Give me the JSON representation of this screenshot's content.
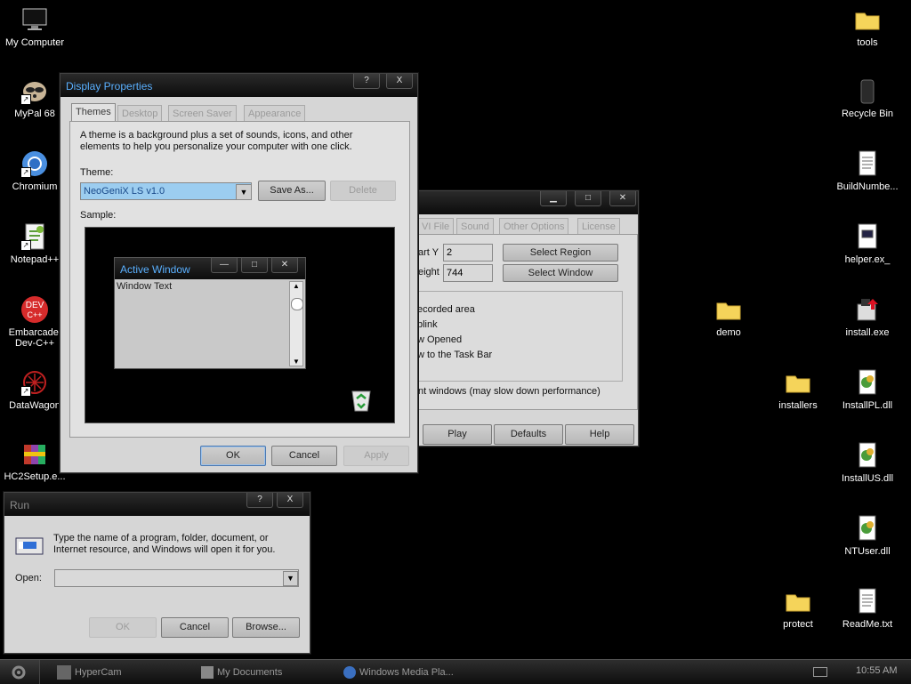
{
  "desktop_left": [
    {
      "name": "My Computer"
    },
    {
      "name": "MyPal 68"
    },
    {
      "name": "Chromium"
    },
    {
      "name": "Notepad++"
    },
    {
      "name": "Embarcadero Dev-C++",
      "line1": "Embarcadei",
      "line2": "Dev-C++"
    },
    {
      "name": "DataWagon"
    },
    {
      "name": "HC2Setup.e..."
    }
  ],
  "desktop_right": [
    {
      "name": "tools"
    },
    {
      "name": "Recycle Bin"
    },
    {
      "name": "BuildNumbe..."
    },
    {
      "name": "helper.ex_"
    },
    {
      "name": "install.exe"
    },
    {
      "name": "InstallPL.dll"
    },
    {
      "name": "InstallUS.dll"
    },
    {
      "name": "NTUser.dll"
    },
    {
      "name": "ReadMe.txt"
    },
    {
      "name": "demo"
    },
    {
      "name": "installers"
    },
    {
      "name": "protect"
    }
  ],
  "display_props": {
    "title": "Display Properties",
    "help_btn": "?",
    "close_btn": "X",
    "tabs": [
      "Themes",
      "Desktop",
      "Screen Saver",
      "Appearance"
    ],
    "desc": "A theme is a background plus a set of sounds, icons, and other elements to help you personalize your computer with one click.",
    "theme_label": "Theme:",
    "theme_value": "NeoGeniX LS v1.0",
    "save_as": "Save As...",
    "delete": "Delete",
    "sample_label": "Sample:",
    "sample_window_title": "Active Window",
    "sample_window_text": "Window Text",
    "ok": "OK",
    "cancel": "Cancel",
    "apply": "Apply"
  },
  "hypercam": {
    "tabs": [
      "VI File",
      "Sound",
      "Other Options",
      "License"
    ],
    "start_y_label": "art Y",
    "start_y_value": "2",
    "height_label": "eight",
    "height_value": "744",
    "select_region": "Select Region",
    "select_window": "Select Window",
    "options": [
      "ecorded area",
      "blink",
      "w Opened",
      "w to the Task Bar"
    ],
    "layered_text": "nt windows (may slow down performance)",
    "play": "Play",
    "defaults": "Defaults",
    "help": "Help"
  },
  "run": {
    "title": "Run",
    "help_btn": "?",
    "close_btn": "X",
    "desc_line1": "Type the name of a program, folder, document, or",
    "desc_line2": "Internet resource, and Windows will open it for you.",
    "open_label": "Open:",
    "open_value": "",
    "ok": "OK",
    "cancel": "Cancel",
    "browse": "Browse..."
  },
  "taskbar": {
    "tasks": [
      "HyperCam",
      "My Documents",
      "Windows Media Pla..."
    ],
    "clock": "10:55 AM"
  }
}
